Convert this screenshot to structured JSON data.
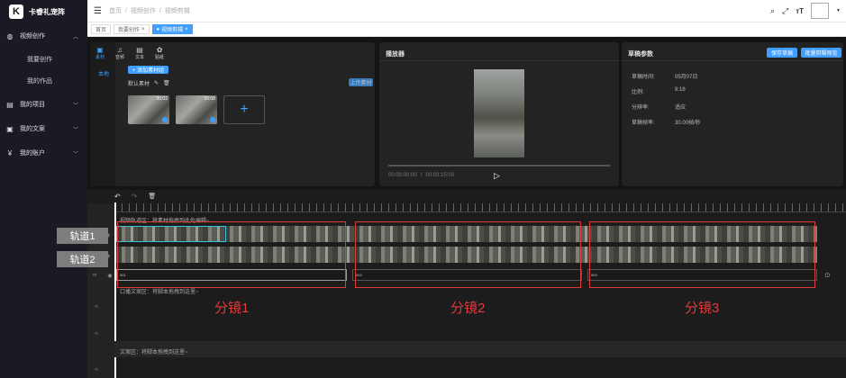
{
  "app": {
    "logo_text": "卡睿礼宠阵",
    "logo_mark": "K"
  },
  "sidebar": {
    "items": [
      {
        "label": "视频创作",
        "icon": "globe-icon",
        "glyph": "◍"
      },
      {
        "label": "我要创作"
      },
      {
        "label": "我的作品"
      },
      {
        "label": "我的项目",
        "icon": "folder-icon",
        "glyph": "▤"
      },
      {
        "label": "我的文案",
        "icon": "doc-icon",
        "glyph": "▣"
      },
      {
        "label": "我的账户",
        "icon": "yen-icon",
        "glyph": "¥"
      }
    ]
  },
  "header": {
    "breadcrumbs": [
      "首页",
      "视频创作",
      "视频剪辑"
    ],
    "separator": "/"
  },
  "tabs": [
    {
      "label": "首页"
    },
    {
      "label": "我要创作",
      "close": "×"
    },
    {
      "label": "视频剪辑",
      "close": "×",
      "active": true
    }
  ],
  "media_panel": {
    "tabs": [
      "素材",
      "音频",
      "文本",
      "贴纸"
    ],
    "side_label": "本地",
    "add_button": "+ 添加素材组",
    "group_label": "默认素材",
    "upload_button": "上传素材",
    "thumbs": [
      {
        "duration": "00:02"
      },
      {
        "duration": "00:08"
      }
    ],
    "add_tile": "+"
  },
  "player": {
    "title": "播放器",
    "time_current": "00:00:00:00",
    "time_sep": "/",
    "time_total": "00:03:15:00",
    "play": "▷"
  },
  "params": {
    "title": "草稿参数",
    "save_button": "保存草稿",
    "batch_button": "批量剪辑预览",
    "rows": [
      {
        "label": "草稿时间:",
        "value": "05月07日"
      },
      {
        "label": "比例:",
        "value": "9:16"
      },
      {
        "label": "分辨率:",
        "value": "适应"
      },
      {
        "label": "草稿帧率:",
        "value": "30.00帧/秒"
      }
    ]
  },
  "timeline": {
    "toolbar": [
      "↶",
      "↷",
      "🗑"
    ],
    "material_hint": "视频轨道区：将素材拖拽到此处编辑~",
    "voice_hint": "口播文案区：将脚本拖拽到这里~",
    "text_hint": "文案区：将脚本拖拽到这里~",
    "audio_labels": [
      "001",
      "002",
      "003"
    ],
    "end_icon": "⊙"
  },
  "annotations": {
    "track_labels": [
      "轨道1",
      "轨道2"
    ],
    "shot_labels": [
      "分镜1",
      "分镜2",
      "分镜3"
    ]
  }
}
